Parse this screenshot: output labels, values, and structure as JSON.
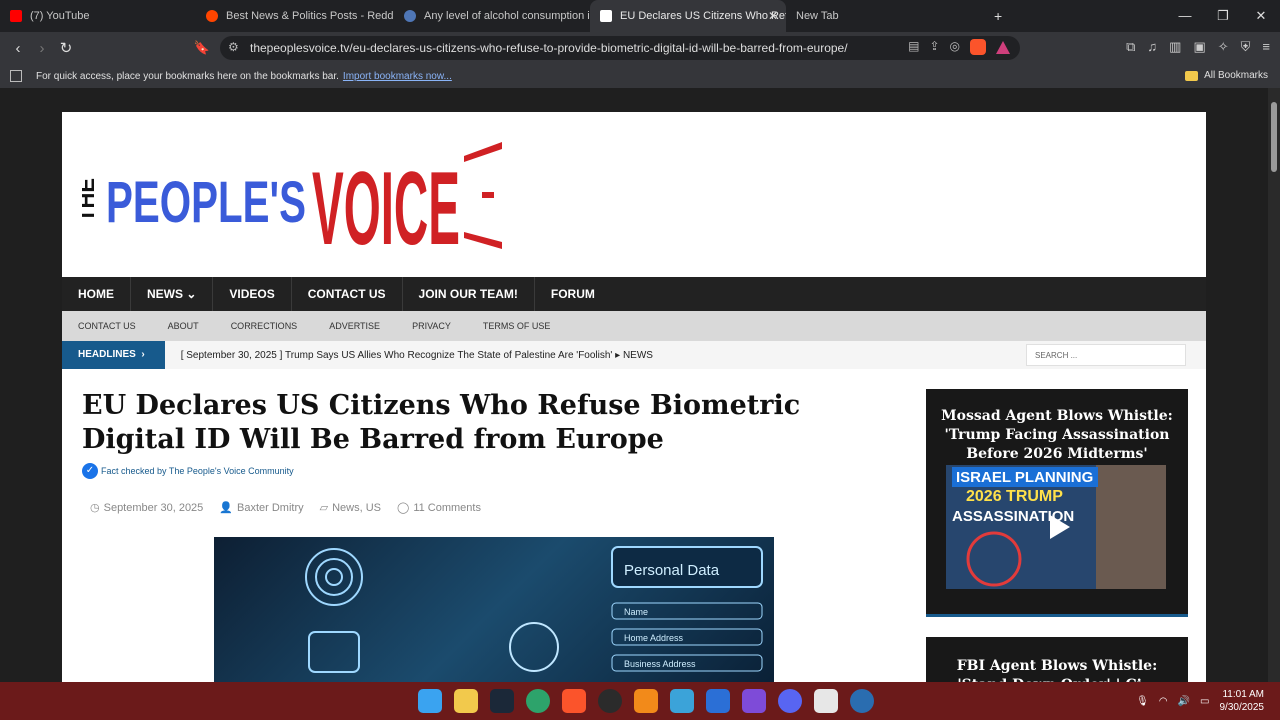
{
  "browser": {
    "tabs": [
      {
        "label": "(7) YouTube",
        "color": "#ff0000"
      },
      {
        "label": "Best News & Politics Posts - Reddit",
        "color": "#ff4500"
      },
      {
        "label": "Any level of alcohol consumption inc",
        "color": "#4f77b7"
      },
      {
        "label": "EU Declares US Citizens Who Ref",
        "color": "#ffffff",
        "active": true
      },
      {
        "label": "New Tab",
        "color": "#777777"
      }
    ],
    "new_tab_icon": "+",
    "url": "thepeoplesvoice.tv/eu-declares-us-citizens-who-refuse-to-provide-biometric-digital-id-will-be-barred-from-europe/",
    "bookmarks_message": "For quick access, place your bookmarks here on the bookmarks bar.",
    "import_link": "Import bookmarks now...",
    "all_bookmarks": "All Bookmarks"
  },
  "site": {
    "logo": {
      "the": "THE",
      "peoples": "PEOPLE'S",
      "voice": "VOICE"
    },
    "main_nav": [
      "HOME",
      "NEWS",
      "VIDEOS",
      "CONTACT US",
      "JOIN OUR TEAM!",
      "FORUM"
    ],
    "sub_nav": [
      "CONTACT US",
      "ABOUT",
      "CORRECTIONS",
      "ADVERTISE",
      "PRIVACY",
      "TERMS OF USE"
    ],
    "headlines_label": "HEADLINES",
    "headline": {
      "date": "[ September 30, 2025 ]",
      "text": "Trump Says US Allies Who Recognize The State of Palestine Are 'Foolish'",
      "category": "NEWS"
    },
    "search_placeholder": "SEARCH ..."
  },
  "article": {
    "title": "EU Declares US Citizens Who Refuse Biometric Digital ID Will Be Barred from Europe",
    "fact_check": "Fact checked by The People's Voice Community",
    "date": "September 30, 2025",
    "author": "Baxter Dmitry",
    "categories": "News, US",
    "comments": "11 Comments",
    "hero_labels": {
      "personal_data": "Personal Data",
      "name": "Name",
      "home_address": "Home Address",
      "business_address": "Business Address"
    }
  },
  "sidebar": {
    "card1": {
      "title": "Mossad Agent Blows Whistle: 'Trump Facing Assassination Before 2026 Midterms'",
      "overlay_line1": "ISRAEL PLANNING",
      "overlay_line2": "2026 TRUMP",
      "overlay_line3": "ASSASSINATION"
    },
    "card2": {
      "title": "FBI Agent Blows Whistle: 'Stand Down Order' | Ci..."
    }
  },
  "taskbar": {
    "time": "11:01 AM",
    "date": "9/30/2025",
    "apps": [
      "windows",
      "file-explorer",
      "steam",
      "edge",
      "brave",
      "obs",
      "vlc",
      "notepad",
      "word",
      "clapper",
      "discord",
      "store",
      "settings"
    ]
  },
  "colors": {
    "logo_blue": "#3a5bd9",
    "logo_red": "#d02124",
    "nav_dark": "#222222",
    "accent": "#175a8c"
  }
}
